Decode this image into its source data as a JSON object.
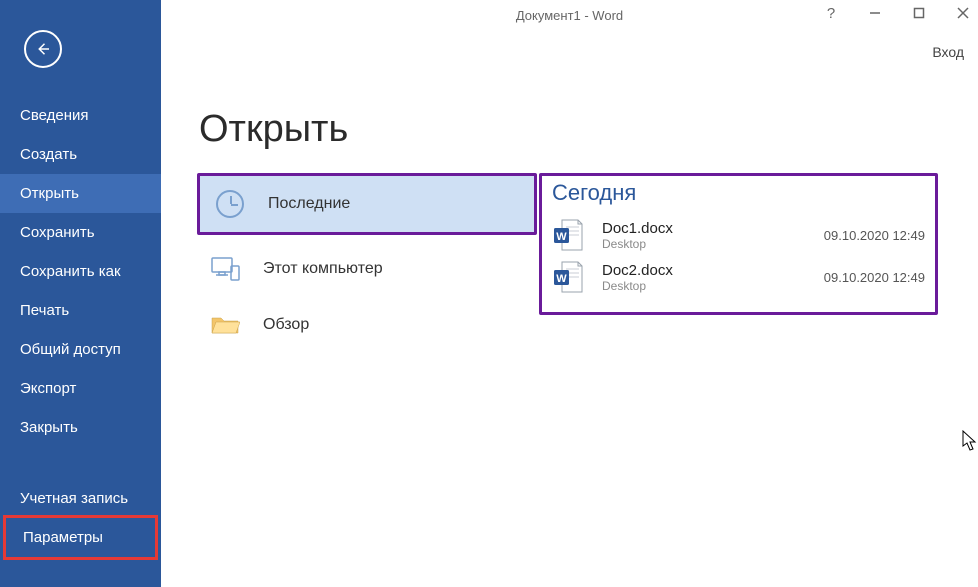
{
  "window": {
    "title": "Документ1 - Word",
    "help": "?",
    "signin": "Вход"
  },
  "sidebar": {
    "items": [
      {
        "label": "Сведения"
      },
      {
        "label": "Создать"
      },
      {
        "label": "Открыть",
        "selected": true
      },
      {
        "label": "Сохранить"
      },
      {
        "label": "Сохранить как"
      },
      {
        "label": "Печать"
      },
      {
        "label": "Общий доступ"
      },
      {
        "label": "Экспорт"
      },
      {
        "label": "Закрыть"
      }
    ],
    "footer": [
      {
        "label": "Учетная запись"
      },
      {
        "label": "Параметры",
        "highlight": "red"
      }
    ]
  },
  "page": {
    "heading": "Открыть"
  },
  "sources": [
    {
      "label": "Последние",
      "selected": true,
      "icon": "clock"
    },
    {
      "label": "Этот компьютер",
      "icon": "pc"
    },
    {
      "label": "Обзор",
      "icon": "folder"
    }
  ],
  "files": {
    "group": "Сегодня",
    "items": [
      {
        "name": "Doc1.docx",
        "location": "Desktop",
        "time": "09.10.2020 12:49"
      },
      {
        "name": "Doc2.docx",
        "location": "Desktop",
        "time": "09.10.2020 12:49"
      }
    ]
  }
}
